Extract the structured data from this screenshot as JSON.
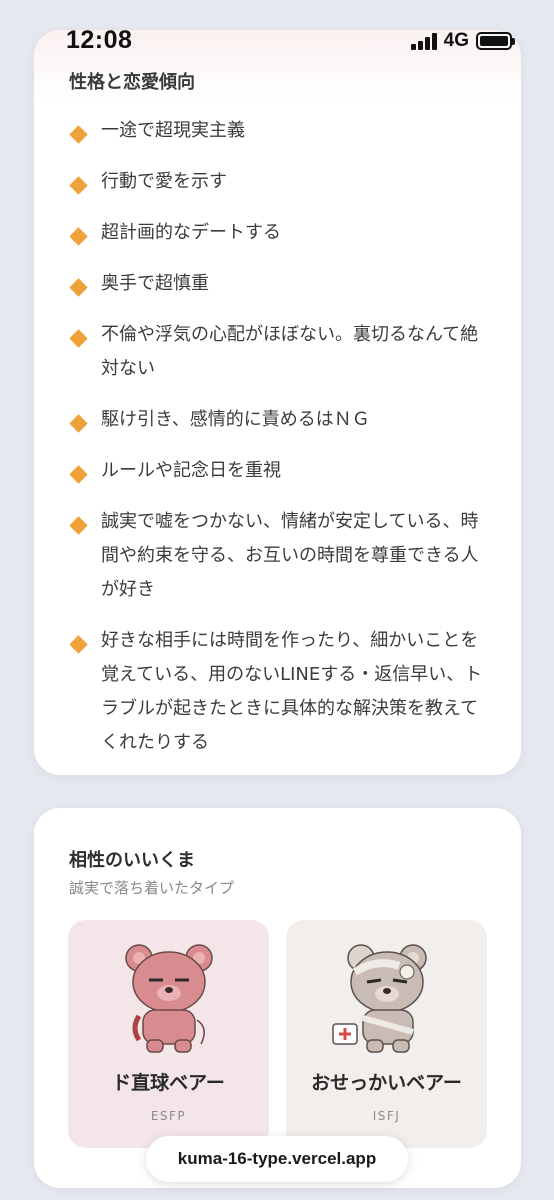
{
  "status_bar": {
    "time": "12:08",
    "network": "4G",
    "battery_level": 1.0
  },
  "personality": {
    "title": "性格と恋愛傾向",
    "bullet_color": "#f0a23a",
    "items": [
      "一途で超現実主義",
      "行動で愛を示す",
      "超計画的なデートする",
      "奥手で超慎重",
      "不倫や浮気の心配がほぼない。裏切るなんて絶対ない",
      "駆け引き、感情的に責めるはＮＧ",
      "ルールや記念日を重視",
      "誠実で嘘をつかない、情緒が安定している、時間や約束を守る、お互いの時間を尊重できる人が好き",
      "好きな相手には時間を作ったり、細かいことを覚えている、用のないLINEする・返信早い、トラブルが起きたときに具体的な解決策を教えてくれたりする"
    ]
  },
  "compatibility": {
    "title": "相性のいいくま",
    "subtitle": "誠実で落ち着いたタイプ",
    "bears": [
      {
        "name": "ド直球ベアー",
        "type": "ESFP",
        "background": "#f4e6e8",
        "bear_color": "#d98c8f"
      },
      {
        "name": "おせっかいベアー",
        "type": "ISFJ",
        "background": "#f1eeec",
        "bear_color": "#c9bcb4"
      }
    ]
  },
  "url_bar": {
    "url": "kuma-16-type.vercel.app"
  }
}
